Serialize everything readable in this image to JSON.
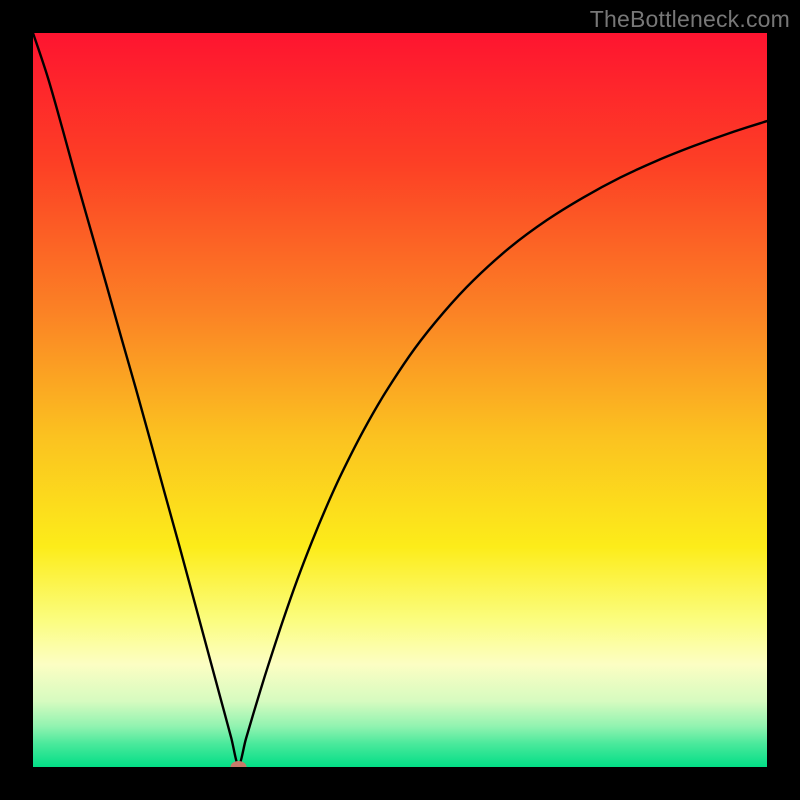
{
  "watermark": "TheBottleneck.com",
  "chart_data": {
    "type": "line",
    "title": "",
    "xlabel": "",
    "ylabel": "",
    "xlim": [
      0,
      100
    ],
    "ylim": [
      0,
      100
    ],
    "grid": false,
    "legend": false,
    "minimum_marker": {
      "x": 28,
      "y": 0,
      "color": "#c77a6a"
    },
    "background_gradient_stops": [
      {
        "offset": 0.0,
        "color": "#fe1430"
      },
      {
        "offset": 0.18,
        "color": "#fd4025"
      },
      {
        "offset": 0.38,
        "color": "#fb8225"
      },
      {
        "offset": 0.55,
        "color": "#fbc220"
      },
      {
        "offset": 0.7,
        "color": "#fcec1a"
      },
      {
        "offset": 0.8,
        "color": "#fbfd7f"
      },
      {
        "offset": 0.86,
        "color": "#fcfec3"
      },
      {
        "offset": 0.91,
        "color": "#d7fbc0"
      },
      {
        "offset": 0.945,
        "color": "#90f3b0"
      },
      {
        "offset": 0.968,
        "color": "#4be99c"
      },
      {
        "offset": 1.0,
        "color": "#02de86"
      }
    ],
    "series": [
      {
        "name": "curve",
        "x": [
          0.0,
          2,
          4,
          6,
          8,
          10,
          12,
          14,
          16,
          18,
          20,
          22,
          24,
          25,
          26,
          27,
          28,
          29,
          30,
          31,
          32,
          34,
          36,
          38,
          40,
          42,
          45,
          48,
          52,
          56,
          60,
          65,
          70,
          75,
          80,
          85,
          90,
          95,
          100
        ],
        "y": [
          100,
          94.0,
          87.0,
          79.7,
          72.7,
          65.7,
          58.6,
          51.6,
          44.4,
          37.1,
          29.9,
          22.5,
          15.1,
          11.4,
          7.7,
          4.0,
          0.3,
          3.8,
          7.2,
          10.5,
          13.7,
          19.8,
          25.5,
          30.7,
          35.5,
          39.9,
          45.8,
          51.0,
          57.0,
          62.0,
          66.3,
          70.8,
          74.5,
          77.6,
          80.3,
          82.6,
          84.6,
          86.4,
          88.0
        ]
      }
    ]
  }
}
